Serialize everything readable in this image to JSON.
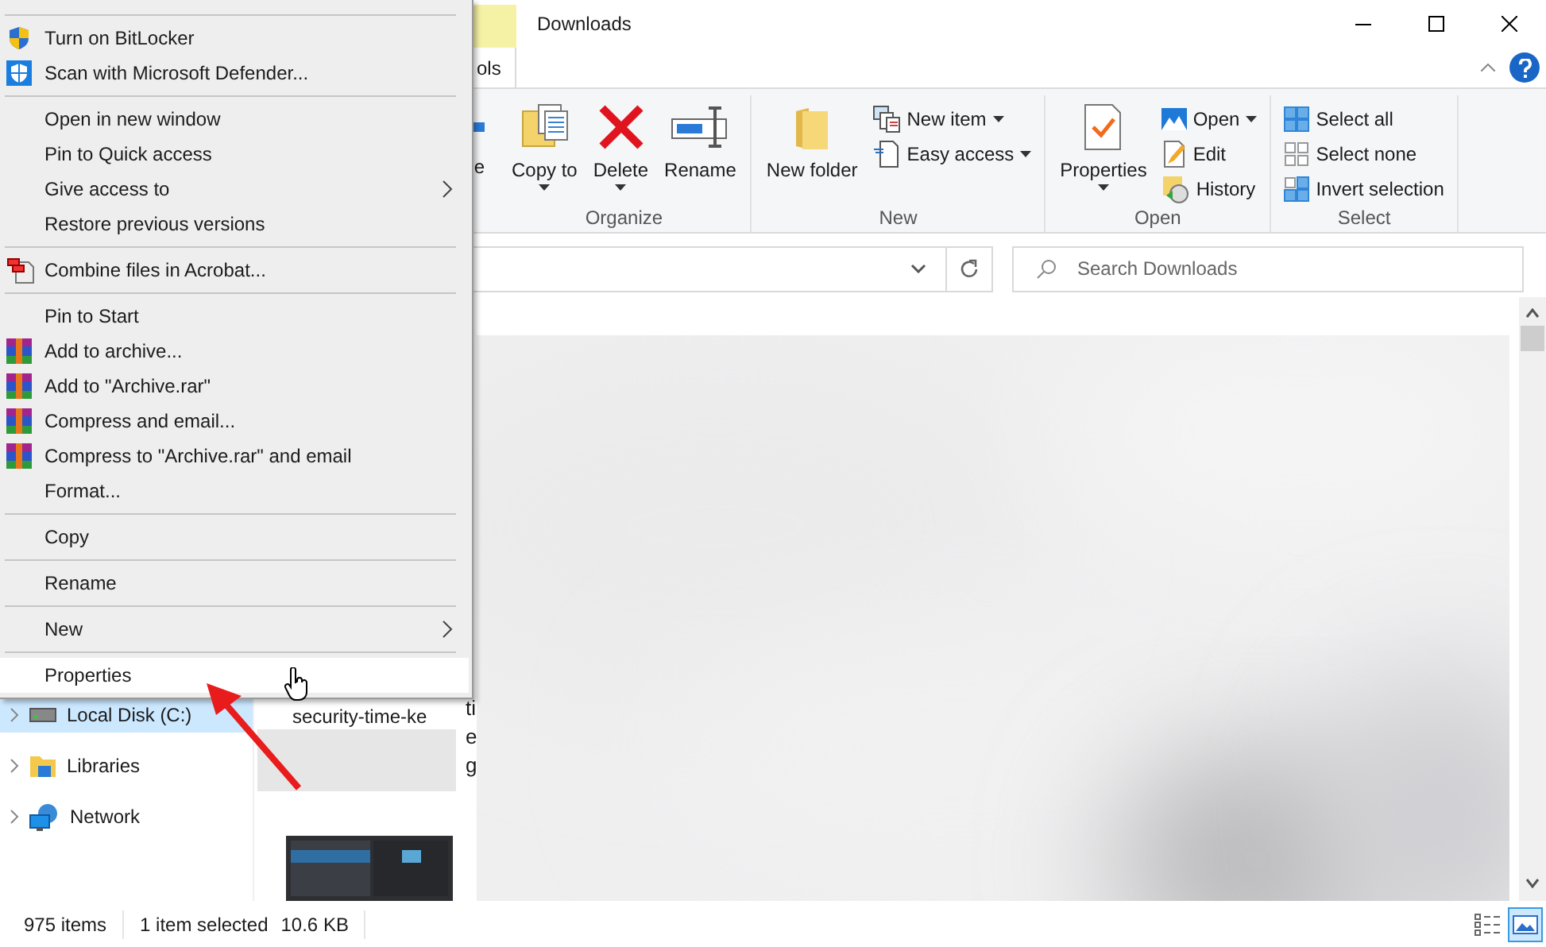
{
  "window": {
    "title": "Downloads",
    "ribbon_tab": "ols"
  },
  "ribbon": {
    "partial_button": "e",
    "groups": [
      {
        "label": "Organize",
        "items": [
          {
            "kind": "large",
            "label": "Copy to",
            "dropdown": true
          },
          {
            "kind": "large",
            "label": "Delete",
            "dropdown": true
          },
          {
            "kind": "large",
            "label": "Rename",
            "dropdown": false
          }
        ]
      },
      {
        "label": "New",
        "items": [
          {
            "kind": "large",
            "label": "New folder",
            "dropdown": false
          },
          {
            "kind": "small",
            "label": "New item",
            "dropdown": true
          },
          {
            "kind": "small",
            "label": "Easy access",
            "dropdown": true
          }
        ]
      },
      {
        "label": "Open",
        "items": [
          {
            "kind": "large",
            "label": "Properties",
            "dropdown": true
          },
          {
            "kind": "small",
            "label": "Open",
            "dropdown": true
          },
          {
            "kind": "small",
            "label": "Edit",
            "dropdown": false
          },
          {
            "kind": "small",
            "label": "History",
            "dropdown": false
          }
        ]
      },
      {
        "label": "Select",
        "items": [
          {
            "kind": "small",
            "label": "Select all",
            "dropdown": false
          },
          {
            "kind": "small",
            "label": "Select none",
            "dropdown": false
          },
          {
            "kind": "small",
            "label": "Invert selection",
            "dropdown": false
          }
        ]
      }
    ]
  },
  "search": {
    "placeholder": "Search Downloads"
  },
  "context_menu": [
    {
      "kind": "separator"
    },
    {
      "kind": "item",
      "label": "Turn on BitLocker",
      "submenu": false,
      "selected": false
    },
    {
      "kind": "item",
      "label": "Scan with Microsoft Defender...",
      "submenu": false,
      "selected": false
    },
    {
      "kind": "separator"
    },
    {
      "kind": "item",
      "label": "Open in new window",
      "submenu": false,
      "selected": false
    },
    {
      "kind": "item",
      "label": "Pin to Quick access",
      "submenu": false,
      "selected": false
    },
    {
      "kind": "item",
      "label": "Give access to",
      "submenu": true,
      "selected": false
    },
    {
      "kind": "item",
      "label": "Restore previous versions",
      "submenu": false,
      "selected": false
    },
    {
      "kind": "separator"
    },
    {
      "kind": "item",
      "label": "Combine files in Acrobat...",
      "submenu": false,
      "selected": false
    },
    {
      "kind": "separator"
    },
    {
      "kind": "item",
      "label": "Pin to Start",
      "submenu": false,
      "selected": false
    },
    {
      "kind": "item",
      "label": "Add to archive...",
      "submenu": false,
      "selected": false
    },
    {
      "kind": "item",
      "label": "Add to \"Archive.rar\"",
      "submenu": false,
      "selected": false
    },
    {
      "kind": "item",
      "label": "Compress and email...",
      "submenu": false,
      "selected": false
    },
    {
      "kind": "item",
      "label": "Compress to \"Archive.rar\" and email",
      "submenu": false,
      "selected": false
    },
    {
      "kind": "item",
      "label": "Format...",
      "submenu": false,
      "selected": false
    },
    {
      "kind": "separator"
    },
    {
      "kind": "item",
      "label": "Copy",
      "submenu": false,
      "selected": false
    },
    {
      "kind": "separator"
    },
    {
      "kind": "item",
      "label": "Rename",
      "submenu": false,
      "selected": false
    },
    {
      "kind": "separator"
    },
    {
      "kind": "item",
      "label": "New",
      "submenu": true,
      "selected": false
    },
    {
      "kind": "separator"
    },
    {
      "kind": "item",
      "label": "Properties",
      "submenu": false,
      "selected": true
    }
  ],
  "navigation": [
    {
      "label": "Local Disk (C:)",
      "selected": true
    },
    {
      "label": "Libraries",
      "selected": false
    },
    {
      "label": "Network",
      "selected": false
    }
  ],
  "files": {
    "label": "security-time-ke",
    "cut_label_lines": [
      "ti",
      "e",
      "g"
    ]
  },
  "status_bar": {
    "items": [
      "975 items",
      "1 item selected",
      "10.6 KB"
    ],
    "views": [
      {
        "kind": "details",
        "selected": false
      },
      {
        "kind": "large-icons",
        "selected": true
      }
    ]
  }
}
